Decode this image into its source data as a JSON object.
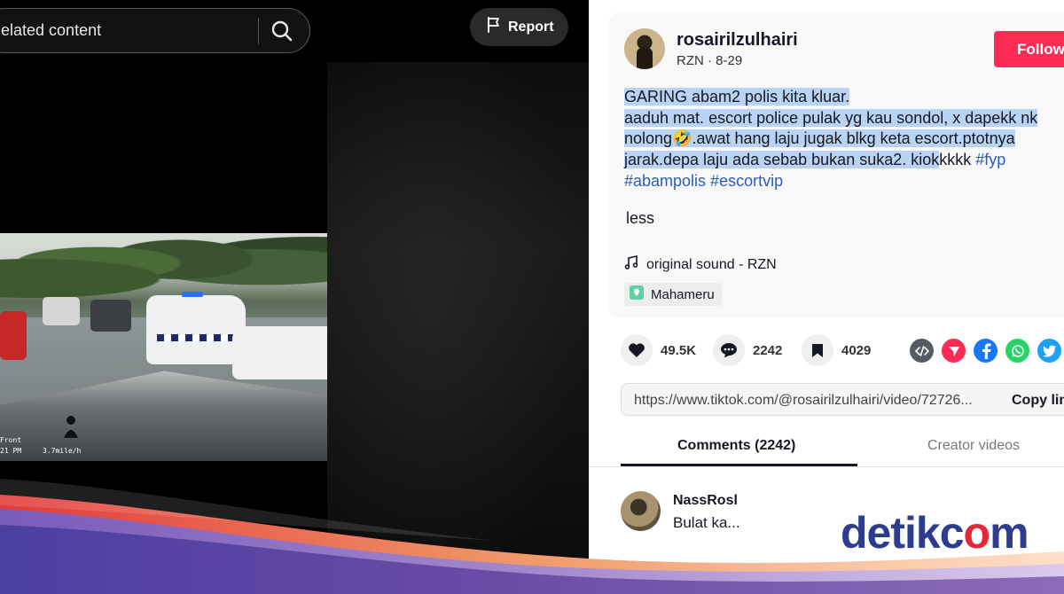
{
  "search": {
    "text": "elated content"
  },
  "report": {
    "label": "Report"
  },
  "video": {
    "osd_front": "Front",
    "osd_time": "21 PM",
    "osd_speed": "3.7mile/h"
  },
  "author": {
    "username": "rosairilzulhairi",
    "meta": "RZN · 8-29",
    "follow_label": "Follow"
  },
  "caption": {
    "line1": "GARING abam2 polis kita kluar.",
    "line2": "aaduh mat. escort police pulak yg kau sondol, x dapekk nk",
    "line3": "nolong🤣.awat hang laju jugak blkg keta escort.ptotnya",
    "line4": "jarak.depa laju ada sebab bukan suka2. kiok",
    "line4b": "kkkk ",
    "hashtags1": "#fyp",
    "hashtags2": "#abampolis #escortvip",
    "less": "less"
  },
  "sound": {
    "label": "original sound - RZN"
  },
  "location": {
    "label": "Mahameru"
  },
  "stats": {
    "likes": "49.5K",
    "comments": "2242",
    "saves": "4029"
  },
  "share": {
    "icons": [
      "embed-icon",
      "send-icon",
      "facebook-icon",
      "whatsapp-icon",
      "twitter-icon"
    ]
  },
  "link": {
    "url": "https://www.tiktok.com/@rosairilzulhairi/video/72726...",
    "copy_label": "Copy link"
  },
  "tabs": {
    "comments": "Comments (2242)",
    "creator": "Creator videos"
  },
  "comment": {
    "user": "NassRosl",
    "text": "Bulat  ka..."
  },
  "watermark": {
    "text_a": "detik",
    "text_o": "c",
    "text_b": "o",
    "text_c": "m"
  },
  "colors": {
    "follow": "#fe2c55",
    "hashtag": "#2b5db9",
    "highlight": "#b8d3f4",
    "watermark_blue": "#2c3c8f",
    "watermark_red": "#e6273b"
  }
}
